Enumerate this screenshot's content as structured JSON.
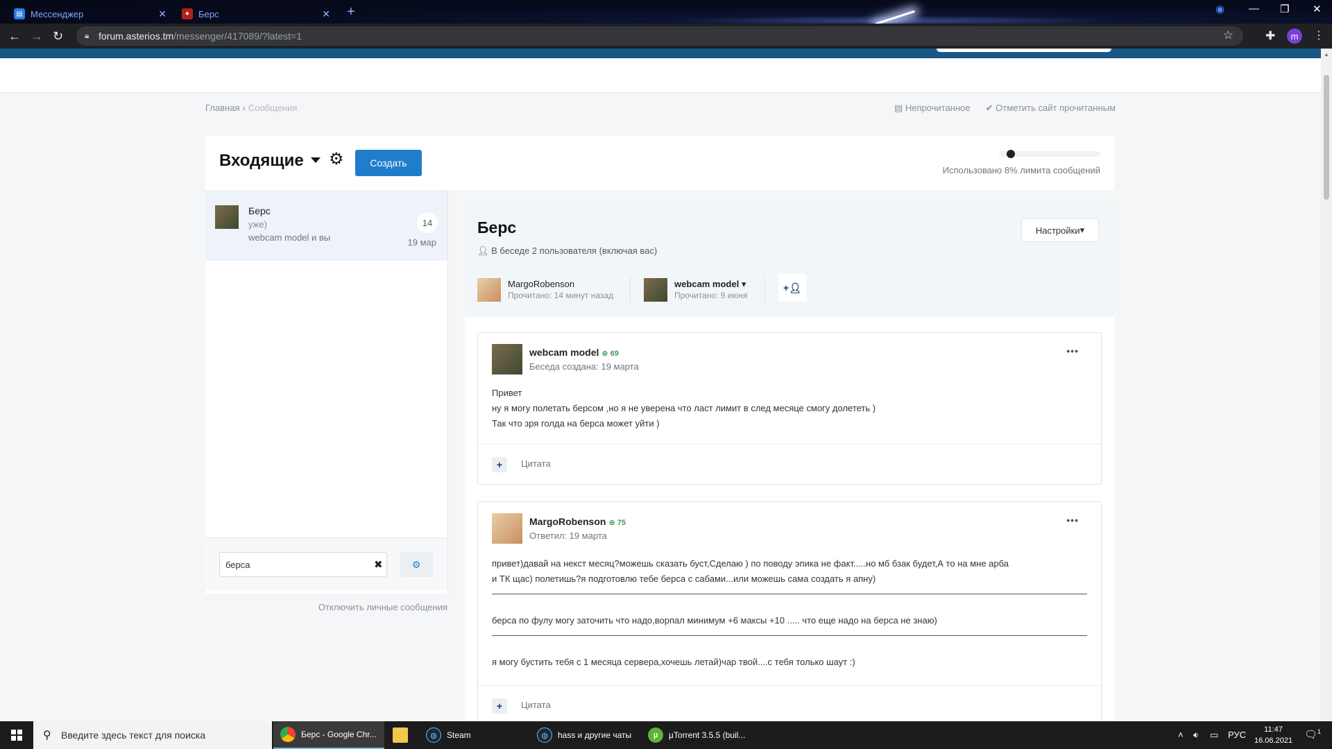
{
  "browser": {
    "tabs": [
      {
        "label": "Мессенджер"
      },
      {
        "label": "Берс"
      }
    ],
    "url_host": "forum.asterios.tm",
    "url_path": "/messenger/417089/?latest=1",
    "profile_initial": "m"
  },
  "breadcrumb": {
    "home": "Главная",
    "current": "Сообщения"
  },
  "toplinks": {
    "unread": "Непрочитанное",
    "mark_read": "Отметить сайт прочитанным"
  },
  "inbox": {
    "title": "Входящие",
    "create_label": "Создать",
    "limit_text": "Использовано 8% лимита сообщений",
    "limit_used_percent": 8
  },
  "conversation_list": [
    {
      "title": "Берс",
      "snippet": "уже)",
      "participants": "webcam model и вы",
      "count": "14",
      "date": "19 мар"
    }
  ],
  "search": {
    "value": "берса"
  },
  "disable_link": "Отключить личные сообщения",
  "conversation": {
    "title": "Берс",
    "meta": "В беседе 2 пользователя (включая вас)",
    "settings_label": "Настройки",
    "participants": [
      {
        "name": "MargoRobenson",
        "read": "Прочитано: 14 минут назад"
      },
      {
        "name": "webcam model",
        "read": "Прочитано: 9 июня"
      }
    ]
  },
  "messages": [
    {
      "author": "webcam model",
      "rep": "69",
      "when": "Беседа создана: 19 марта",
      "lines": [
        "Привет",
        "ну я могу полетать берсом ,но я не уверена что ласт лимит в след месяце смогу долететь )",
        "Так что зря голда на берса может уйти )"
      ],
      "quote_label": "Цитата"
    },
    {
      "author": "MargoRobenson",
      "rep": "75",
      "when": "Ответил: 19 марта",
      "para1_line1": "привет)давай на некст месяц?можешь сказать буст,Сделаю ) по поводу эпика не факт.....но мб бзак будет,А то на мне арба",
      "para1_line2": "и ТК щас) полетишь?я подготовлю тебе берса с сабами...или можешь сама создать я апну)",
      "para2": "берса по фулу могу заточить что надо,ворпал минимум +6 максы +10 ..... что еще надо на берса не знаю)",
      "para3": "я могу бустить тебя с 1 месяца сервера,хочешь летай)чар твой....с тебя только шаут :)",
      "quote_label": "Цитата"
    }
  ],
  "taskbar": {
    "search_placeholder": "Введите здесь текст для поиска",
    "apps": [
      {
        "label": "Берс - Google Chr..."
      },
      {
        "label": "Steam"
      },
      {
        "label": "hass и другие чаты"
      },
      {
        "label": "µTorrent 3.5.5  (buil..."
      }
    ],
    "lang": "РУС",
    "time": "11:47",
    "date": "16.06.2021",
    "notif_count": "1"
  },
  "colors": {
    "accent": "#1f7dcb",
    "site_bar": "#185886",
    "reputation": "#3d9b57"
  }
}
